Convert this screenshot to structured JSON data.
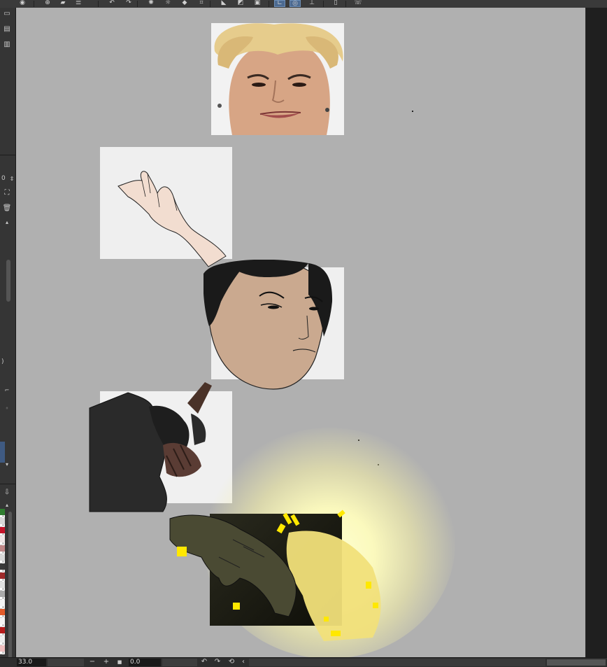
{
  "toolbar": {
    "buttons": [
      {
        "name": "camera-icon",
        "glyph": "◉"
      },
      {
        "name": "add-layer-icon",
        "glyph": "⊕"
      },
      {
        "name": "new-canvas-icon",
        "glyph": "▰"
      },
      {
        "name": "menu-icon",
        "glyph": "☰"
      },
      {
        "name": "undo-icon",
        "glyph": "↶"
      },
      {
        "name": "redo-icon",
        "glyph": "↷"
      },
      {
        "name": "loading-icon",
        "glyph": "✺"
      },
      {
        "name": "sun-icon",
        "glyph": "☼"
      },
      {
        "name": "fill-icon",
        "glyph": "◆"
      },
      {
        "name": "transform-icon",
        "glyph": "⌗"
      },
      {
        "name": "ruler-icon",
        "glyph": "◣"
      },
      {
        "name": "mask-icon",
        "glyph": "◩"
      },
      {
        "name": "snap-icon",
        "glyph": "▣"
      },
      {
        "name": "snap-ruler-icon",
        "glyph": "∟"
      },
      {
        "name": "snap-circle-icon",
        "glyph": "◎"
      },
      {
        "name": "guide-icon",
        "glyph": "⊥"
      },
      {
        "name": "device-icon",
        "glyph": "▯"
      },
      {
        "name": "help-icon",
        "glyph": "☏"
      }
    ]
  },
  "left_panel": {
    "value_label": "0",
    "paren_label_top": ")",
    "paren_label_bottom": ")",
    "colors": [
      "#2f7d2f",
      "#d8d8d8",
      "#c4142a",
      "#f0e6e6",
      "#c08888",
      "#d9d9d9",
      "#3a3a3a",
      "#9f2b2b",
      "#e0e0e0",
      "#aaaaaa",
      "#f5f5f5",
      "#e25b2a",
      "#f5f5f5",
      "#b51c1c",
      "#eeeeee",
      "#f0c0c0"
    ]
  },
  "status_bar": {
    "zoom_value": "33.0",
    "angle_value": "0.0",
    "zoom_out_glyph": "−",
    "zoom_in_glyph": "+",
    "fit_glyph": "■",
    "rotate_left_glyph": "↶",
    "rotate_right_glyph": "↷",
    "reset_rotation_glyph": "⟲",
    "collapse_glyph": "‹"
  },
  "canvas": {
    "background_color": "#b0b0b0",
    "panel_color": "#efefef",
    "skin_color": "#caa98f",
    "glow_color": "#fffcc8",
    "accent_yellow": "#ffe800"
  }
}
